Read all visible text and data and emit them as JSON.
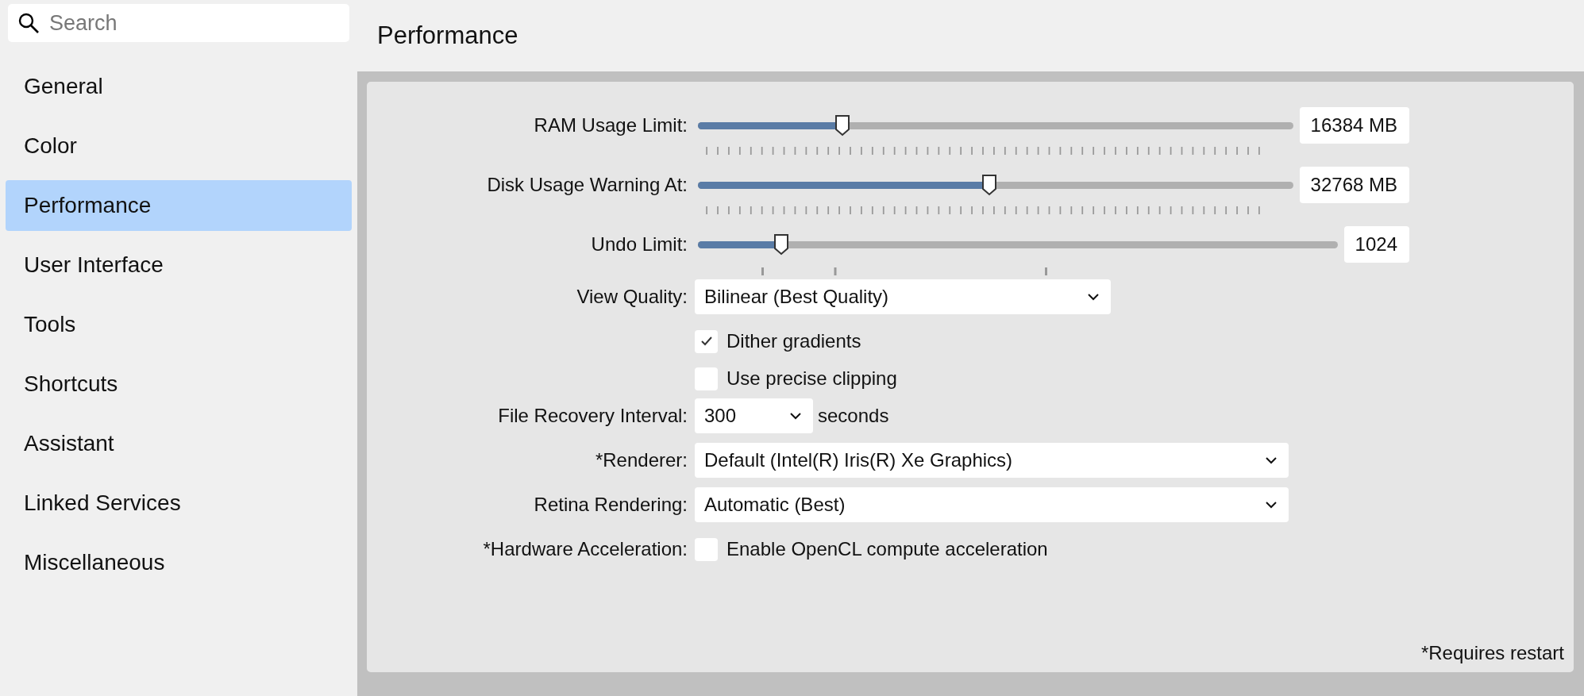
{
  "sidebar": {
    "search": {
      "placeholder": "Search"
    },
    "items": [
      {
        "label": "General",
        "selected": false
      },
      {
        "label": "Color",
        "selected": false
      },
      {
        "label": "Performance",
        "selected": true
      },
      {
        "label": "User Interface",
        "selected": false
      },
      {
        "label": "Tools",
        "selected": false
      },
      {
        "label": "Shortcuts",
        "selected": false
      },
      {
        "label": "Assistant",
        "selected": false
      },
      {
        "label": "Linked Services",
        "selected": false
      },
      {
        "label": "Miscellaneous",
        "selected": false
      }
    ]
  },
  "page": {
    "title": "Performance",
    "footnote": "*Requires restart"
  },
  "settings": [
    {
      "kind": "ticked_slider",
      "label": "RAM Usage Limit:",
      "level": 0.243,
      "value": "16384 MB"
    },
    {
      "kind": "ticked_slider",
      "label": "Disk Usage Warning At:",
      "level": 0.489,
      "value": "32768 MB"
    },
    {
      "kind": "marked_slider",
      "label": "Undo Limit:",
      "level": 0.13,
      "value": "1024"
    },
    {
      "kind": "dropdown",
      "label": "View Quality:",
      "value": "Bilinear (Best Quality)"
    },
    {
      "kind": "checkbox",
      "text": "Dither gradients",
      "checked": true
    },
    {
      "kind": "checkbox",
      "text": "Use precise clipping",
      "checked": false
    },
    {
      "kind": "dropdown",
      "label": "File Recovery Interval:",
      "value": "300",
      "suffix": "seconds"
    },
    {
      "kind": "dropdown",
      "label": "*Renderer:",
      "value": "Default (Intel(R) Iris(R) Xe Graphics)"
    },
    {
      "kind": "dropdown",
      "label": "Retina Rendering:",
      "value": "Automatic (Best)"
    },
    {
      "kind": "checkbox",
      "label": "*Hardware Acceleration:",
      "text": "Enable OpenCL compute acceleration",
      "checked": false
    }
  ]
}
